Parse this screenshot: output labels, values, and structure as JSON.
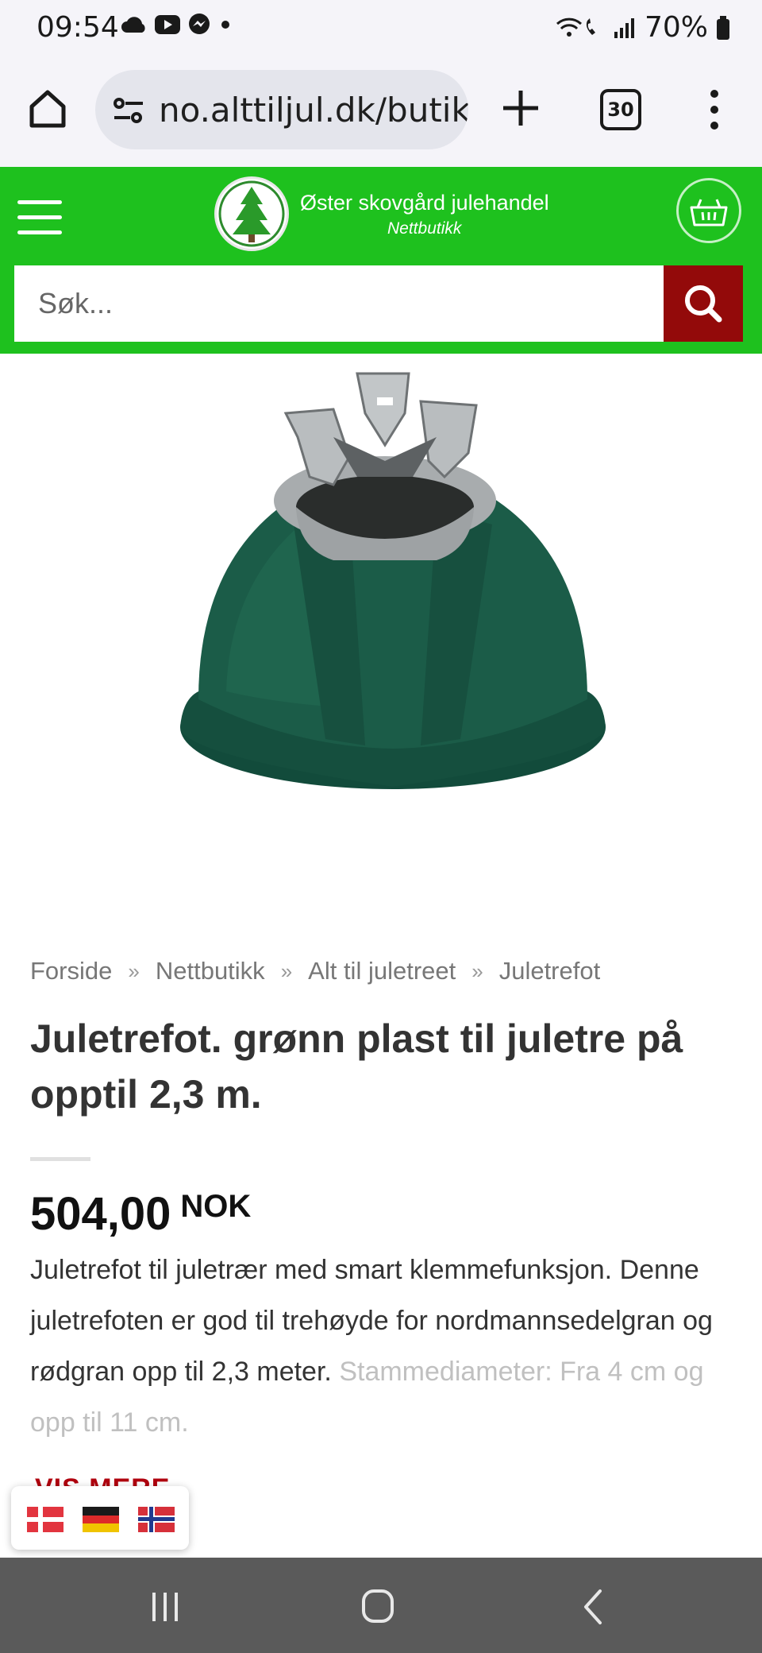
{
  "status_bar": {
    "time": "09:54",
    "battery": "70%",
    "left_icons": [
      "cloud-icon",
      "youtube-icon",
      "messenger-icon",
      "dot-icon"
    ],
    "right_icons": [
      "wifi-call-icon",
      "signal-icon",
      "battery-icon"
    ]
  },
  "browser": {
    "url": "no.alttiljul.dk/butik",
    "tab_count": "30",
    "icons": [
      "home-icon",
      "site-settings-icon",
      "new-tab-icon",
      "tabs-icon",
      "more-menu-icon"
    ]
  },
  "header": {
    "brand_name": "Øster skovgård julehandel",
    "brand_sub": "Nettbutikk",
    "search_placeholder": "Søk...",
    "colors": {
      "header_bg": "#1ec11e",
      "search_button_bg": "#930a0a"
    }
  },
  "breadcrumb": {
    "items": [
      "Forside",
      "Nettbutikk",
      "Alt til juletreet",
      "Juletrefot"
    ],
    "separator": "»"
  },
  "product": {
    "title": "Juletrefot. grønn plast til juletre på opptil 2,3 m.",
    "price": "504,00",
    "currency": "NOK",
    "description": "Juletrefot til juletrær med smart klemmefunksjon. Denne juletrefoten er god til trehøyde for nordmannsedelgran og rødgran opp til 2,3 meter.",
    "description_faded": "Stammediameter: Fra 4 cm og opp til 11 cm.",
    "show_more": "VIS MERE",
    "image_icon": "christmas-tree-stand-image"
  },
  "language_flags": [
    "Danish flag",
    "German flag",
    "Norwegian flag"
  ],
  "nav_bar": [
    "recent-apps-icon",
    "home-nav-icon",
    "back-icon"
  ]
}
